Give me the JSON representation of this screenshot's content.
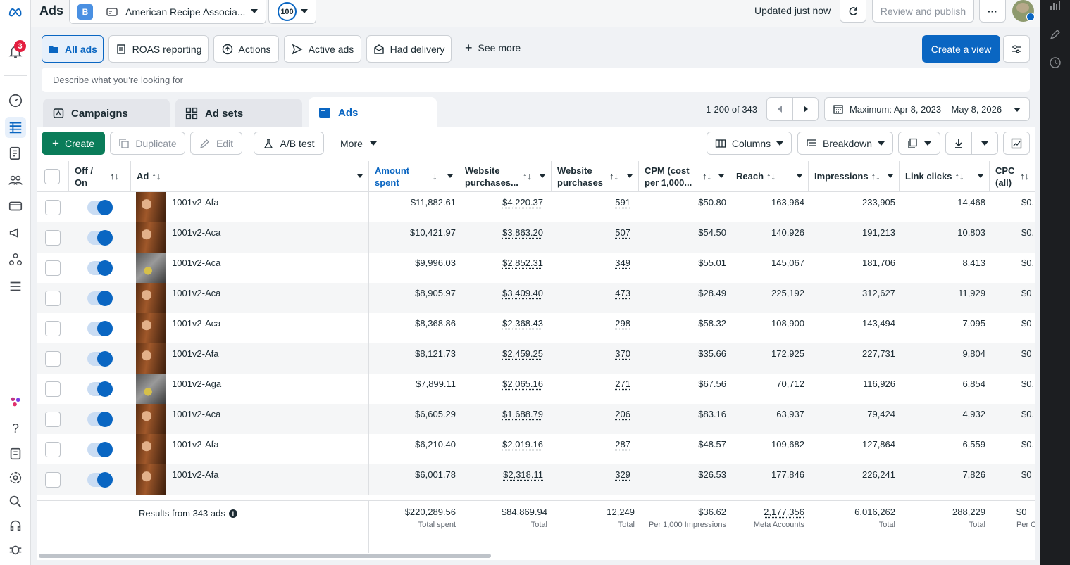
{
  "topbar": {
    "title": "Ads",
    "account_badge": "B",
    "account_name": "American Recipe Associa...",
    "score": "100",
    "updated": "Updated just now",
    "review_publish": "Review and publish",
    "more": "···",
    "notifications_count": "3"
  },
  "filters": {
    "items": [
      "All ads",
      "ROAS reporting",
      "Actions",
      "Active ads",
      "Had delivery",
      "See more"
    ],
    "create_view": "Create a view",
    "search_placeholder": "Describe what you’re looking for"
  },
  "tabs": {
    "campaigns": "Campaigns",
    "adsets": "Ad sets",
    "ads": "Ads"
  },
  "pagination": {
    "range": "1-200 of 343",
    "date_range": "Maximum: Apr 8, 2023 – May 8, 2026"
  },
  "toolbar": {
    "create": "Create",
    "duplicate": "Duplicate",
    "edit": "Edit",
    "ab_test": "A/B test",
    "more": "More",
    "columns": "Columns",
    "breakdown": "Breakdown"
  },
  "columns": {
    "offon": "Off / On",
    "ad": "Ad",
    "amount_spent": "Amount spent",
    "website_purchases_value": "Website purchases...",
    "website_purchases": "Website purchases",
    "cpm": "CPM (cost per 1,000...",
    "reach": "Reach",
    "impressions": "Impressions",
    "link_clicks": "Link clicks",
    "cpc": "CPC (all)"
  },
  "rows": [
    {
      "ad": "1001v2-Afa",
      "spent": "$11,882.61",
      "wpv": "$4,220.37",
      "wp": "591",
      "cpm": "$50.80",
      "reach": "163,964",
      "imp": "233,905",
      "clicks": "14,468",
      "cpc": "$0.",
      "thumb": "warm"
    },
    {
      "ad": "1001v2-Aca",
      "spent": "$10,421.97",
      "wpv": "$3,863.20",
      "wp": "507",
      "cpm": "$54.50",
      "reach": "140,926",
      "imp": "191,213",
      "clicks": "10,803",
      "cpc": "$0.",
      "thumb": "warm"
    },
    {
      "ad": "1001v2-Aca",
      "spent": "$9,996.03",
      "wpv": "$2,852.31",
      "wp": "349",
      "cpm": "$55.01",
      "reach": "145,067",
      "imp": "181,706",
      "clicks": "8,413",
      "cpc": "$0.",
      "thumb": "gray"
    },
    {
      "ad": "1001v2-Aca",
      "spent": "$8,905.97",
      "wpv": "$3,409.40",
      "wp": "473",
      "cpm": "$28.49",
      "reach": "225,192",
      "imp": "312,627",
      "clicks": "11,929",
      "cpc": "$0",
      "thumb": "warm"
    },
    {
      "ad": "1001v2-Aca",
      "spent": "$8,368.86",
      "wpv": "$2,368.43",
      "wp": "298",
      "cpm": "$58.32",
      "reach": "108,900",
      "imp": "143,494",
      "clicks": "7,095",
      "cpc": "$0",
      "thumb": "warm"
    },
    {
      "ad": "1001v2-Afa",
      "spent": "$8,121.73",
      "wpv": "$2,459.25",
      "wp": "370",
      "cpm": "$35.66",
      "reach": "172,925",
      "imp": "227,731",
      "clicks": "9,804",
      "cpc": "$0",
      "thumb": "warm"
    },
    {
      "ad": "1001v2-Aga",
      "spent": "$7,899.11",
      "wpv": "$2,065.16",
      "wp": "271",
      "cpm": "$67.56",
      "reach": "70,712",
      "imp": "116,926",
      "clicks": "6,854",
      "cpc": "$0.",
      "thumb": "gray"
    },
    {
      "ad": "1001v2-Aca",
      "spent": "$6,605.29",
      "wpv": "$1,688.79",
      "wp": "206",
      "cpm": "$83.16",
      "reach": "63,937",
      "imp": "79,424",
      "clicks": "4,932",
      "cpc": "$0.",
      "thumb": "warm"
    },
    {
      "ad": "1001v2-Afa",
      "spent": "$6,210.40",
      "wpv": "$2,019.16",
      "wp": "287",
      "cpm": "$48.57",
      "reach": "109,682",
      "imp": "127,864",
      "clicks": "6,559",
      "cpc": "$0.",
      "thumb": "warm"
    },
    {
      "ad": "1001v2-Afa",
      "spent": "$6,001.78",
      "wpv": "$2,318.11",
      "wp": "329",
      "cpm": "$26.53",
      "reach": "177,846",
      "imp": "226,241",
      "clicks": "7,826",
      "cpc": "$0",
      "thumb": "warm"
    }
  ],
  "footer": {
    "results": "Results from 343 ads",
    "spent": "$220,289.56",
    "spent_label": "Total spent",
    "wpv": "$84,869.94",
    "wpv_label": "Total",
    "wp": "12,249",
    "wp_label": "Total",
    "cpm": "$36.62",
    "cpm_label": "Per 1,000 Impressions",
    "reach": "2,177,356",
    "reach_label": "Meta Accounts",
    "imp": "6,016,262",
    "imp_label": "Total",
    "clicks": "288,229",
    "clicks_label": "Total",
    "cpc": "$0",
    "cpc_label": "Per C"
  },
  "colors": {
    "accent": "#0a66c2",
    "create_green": "#0a7c59",
    "notification_red": "#e41e3f"
  }
}
